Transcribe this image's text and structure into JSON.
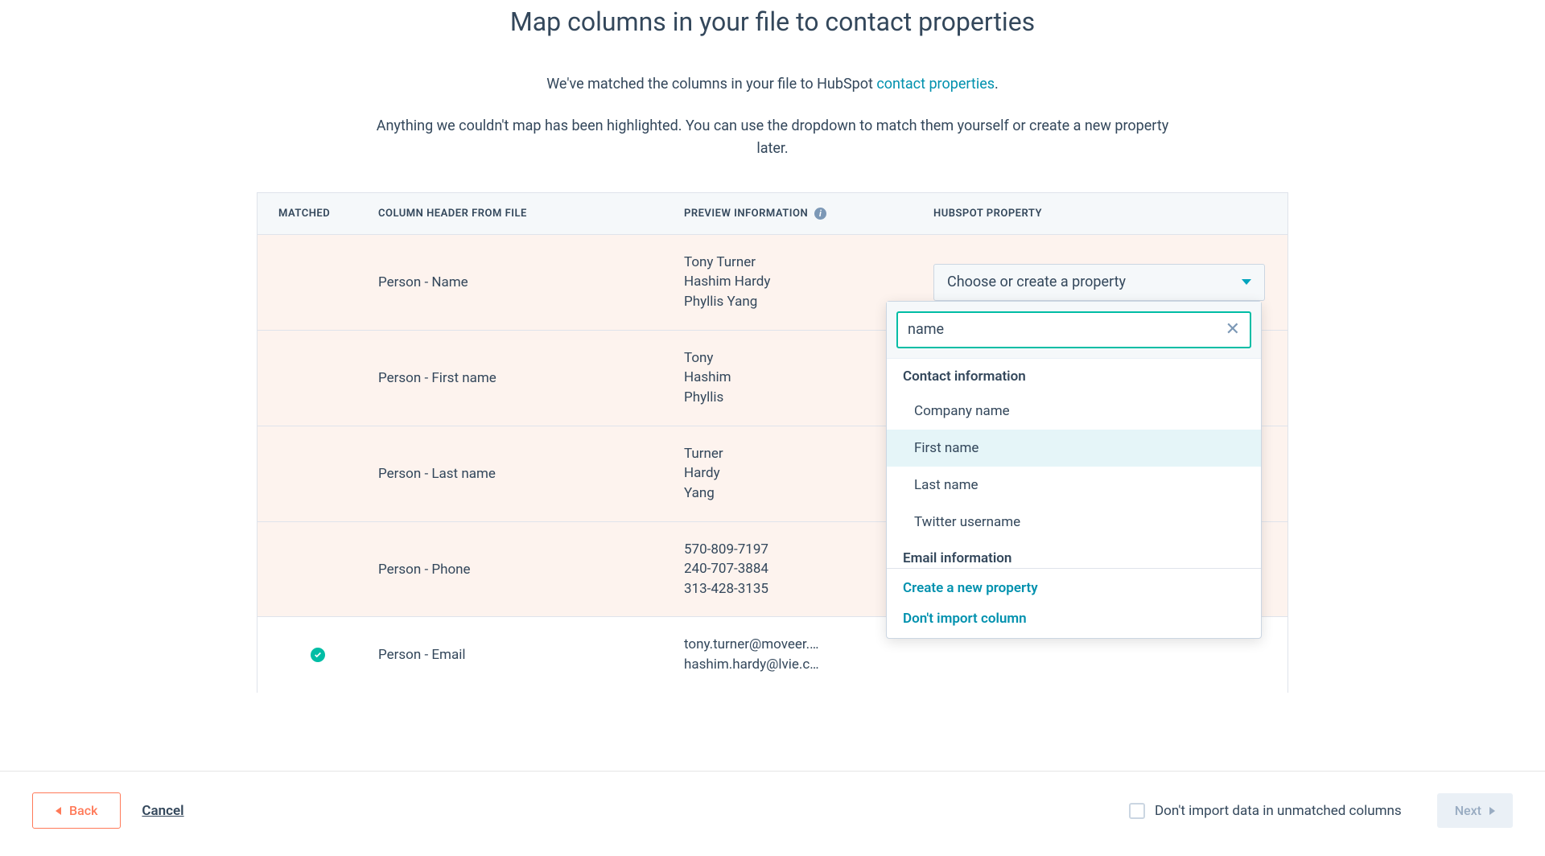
{
  "header": {
    "title": "Map columns in your file to contact properties",
    "subtitle1_prefix": "We've matched the columns in your file to HubSpot ",
    "subtitle1_link": "contact properties",
    "subtitle1_suffix": ".",
    "subtitle2": "Anything we couldn't map has been highlighted. You can use the dropdown to match them yourself or create a new property later."
  },
  "table": {
    "columns": {
      "matched": "MATCHED",
      "header": "COLUMN HEADER FROM FILE",
      "preview": "PREVIEW INFORMATION",
      "property": "HUBSPOT PROPERTY"
    },
    "select_placeholder": "Choose or create a property",
    "rows": [
      {
        "matched": false,
        "header": "Person - Name",
        "preview": "Tony Turner\nHashim Hardy\nPhyllis Yang"
      },
      {
        "matched": false,
        "header": "Person - First name",
        "preview": "Tony\nHashim\nPhyllis"
      },
      {
        "matched": false,
        "header": "Person - Last name",
        "preview": "Turner\nHardy\nYang"
      },
      {
        "matched": false,
        "header": "Person - Phone",
        "preview": "570-809-7197\n240-707-3884\n313-428-3135"
      },
      {
        "matched": true,
        "header": "Person - Email",
        "preview": "tony.turner@moveer.…\nhashim.hardy@lvie.c…"
      }
    ]
  },
  "dropdown": {
    "search_value": "name",
    "groups": [
      {
        "label": "Contact information",
        "options": [
          {
            "label": "Company name",
            "highlight": false
          },
          {
            "label": "First name",
            "highlight": true
          },
          {
            "label": "Last name",
            "highlight": false
          },
          {
            "label": "Twitter username",
            "highlight": false
          }
        ]
      },
      {
        "label": "Email information",
        "options": []
      }
    ],
    "create_new": "Create a new property",
    "dont_import": "Don't import column"
  },
  "footer": {
    "back": "Back",
    "cancel": "Cancel",
    "dont_import_unmatched": "Don't import data in unmatched columns",
    "next": "Next"
  }
}
